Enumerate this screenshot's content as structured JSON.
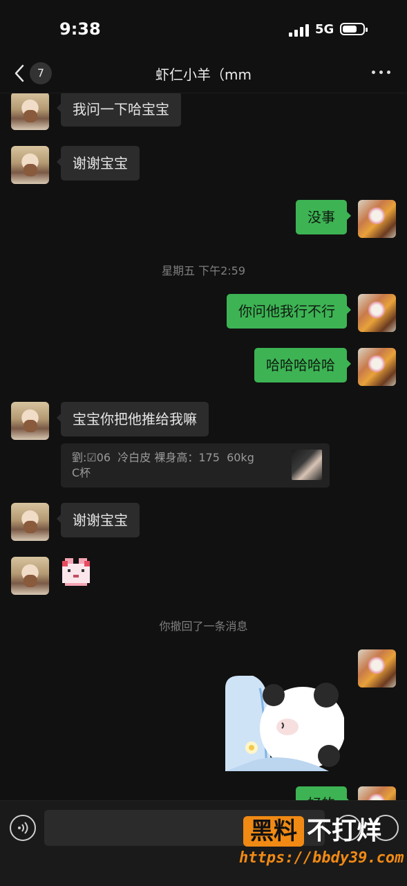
{
  "status_bar": {
    "time": "9:38",
    "network": "5G"
  },
  "navbar": {
    "unread_count": "7",
    "title": "虾仁小羊（mm"
  },
  "messages": [
    {
      "side": "in",
      "text": "我问一下哈宝宝"
    },
    {
      "side": "in",
      "text": "谢谢宝宝"
    },
    {
      "side": "out",
      "text": "没事"
    },
    {
      "side": "out",
      "text": "你问他我行不行"
    },
    {
      "side": "out",
      "text": "哈哈哈哈哈"
    },
    {
      "side": "in",
      "text": "宝宝你把他推给我嘛"
    },
    {
      "side": "in",
      "text": "谢谢宝宝"
    },
    {
      "side": "out",
      "text": "好的"
    }
  ],
  "timestamp": "星期五 下午2:59",
  "quote": {
    "text": "劉:☑06  冷白皮 裸身高：175  60kg\nC杯"
  },
  "system_note": "你撤回了一条消息",
  "input": {
    "placeholder": ""
  },
  "watermark": {
    "badge": "黑料",
    "right": "不打烊",
    "url": "https://bbdy39.com"
  },
  "icons": [
    "back-icon",
    "more-icon",
    "voice-icon",
    "emoji-icon",
    "plus-icon"
  ],
  "colors": {
    "background": "#111111",
    "bubble_out": "#3db354",
    "bubble_in": "#2c2c2c",
    "watermark_accent": "#f08a14"
  }
}
